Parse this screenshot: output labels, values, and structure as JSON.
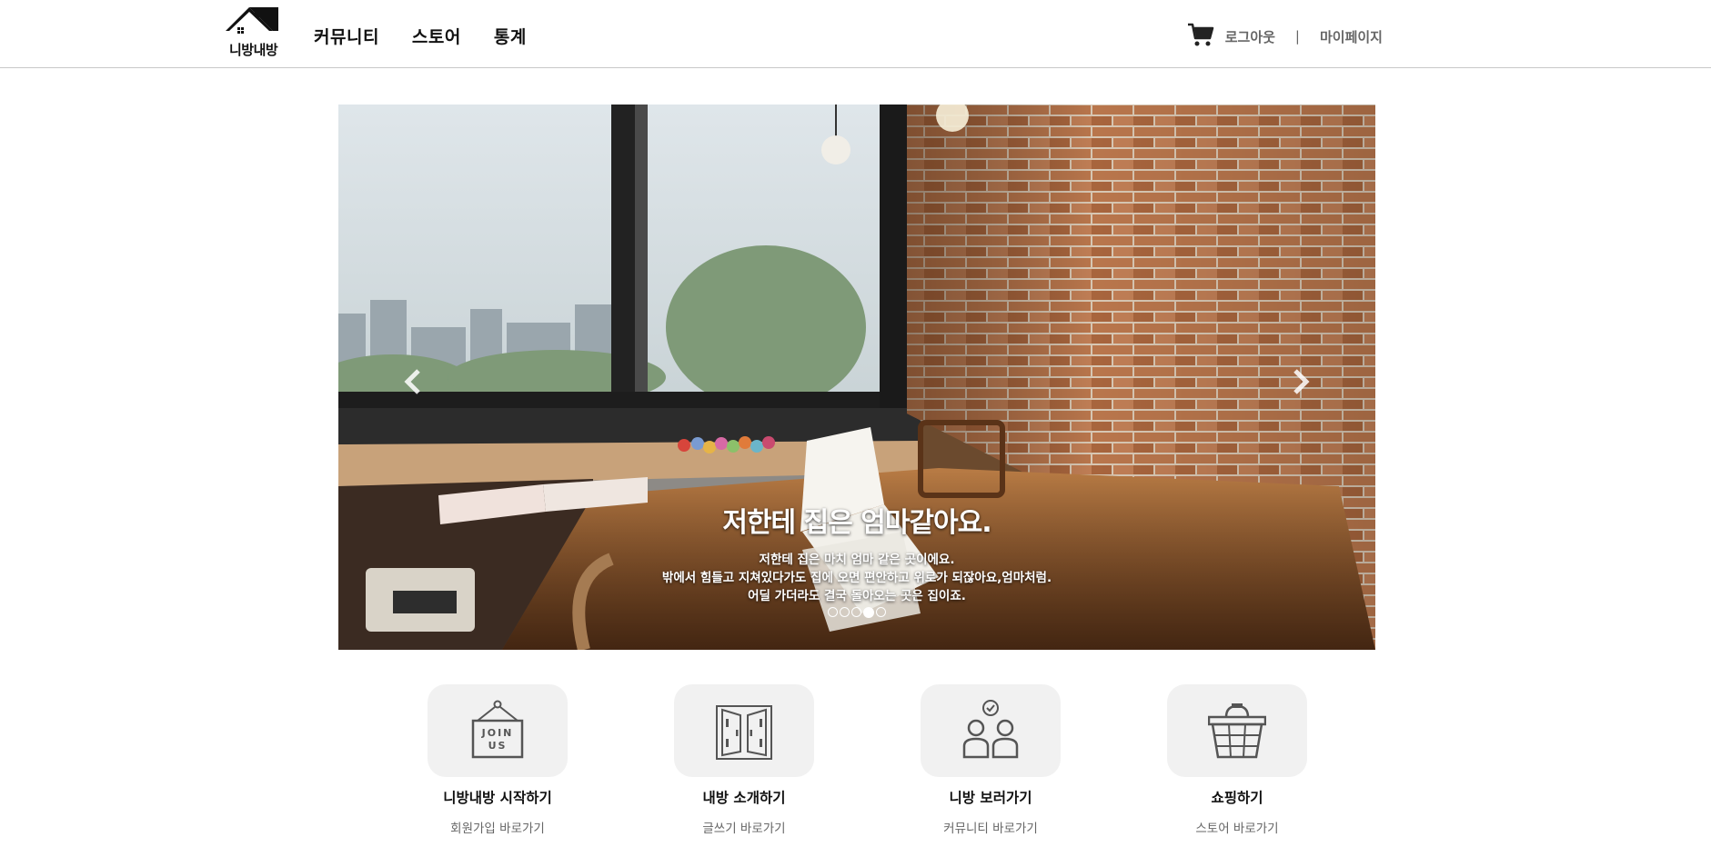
{
  "header": {
    "logo_text": "니방내방",
    "nav": [
      "커뮤니티",
      "스토어",
      "통계"
    ],
    "logout_label": "로그아웃",
    "separator": "|",
    "mypage_label": "마이페이지",
    "cart_icon": "cart-icon"
  },
  "hero": {
    "title": "저한테 집은 엄마같아요.",
    "lines": [
      "저한테 집은 마치 엄마 같은 곳이에요.",
      "밖에서 힘들고 지쳐있다가도 집에 오면 편안하고 위로가 되잖아요,엄마처럼.",
      "어딜 가더라도 결국 돌아오는 곳은 집이죠."
    ],
    "slide_count": 5,
    "active_slide": 4,
    "prev_icon": "chevron-left-icon",
    "next_icon": "chevron-right-icon"
  },
  "features": [
    {
      "title": "니방내방 시작하기",
      "sub": "회원가입 바로가기",
      "icon": "join-us-sign-icon",
      "sign_text": [
        "JOIN",
        "US"
      ]
    },
    {
      "title": "내방 소개하기",
      "sub": "글쓰기 바로가기",
      "icon": "open-door-icon"
    },
    {
      "title": "니방 보러가기",
      "sub": "커뮤니티 바로가기",
      "icon": "people-check-icon"
    },
    {
      "title": "쇼핑하기",
      "sub": "스토어 바로가기",
      "icon": "shopping-basket-icon"
    }
  ],
  "colors": {
    "header_border": "#c8c8c8",
    "tile_bg": "#f1f1f1",
    "muted_text": "#666666",
    "icon_stroke": "#555555"
  }
}
